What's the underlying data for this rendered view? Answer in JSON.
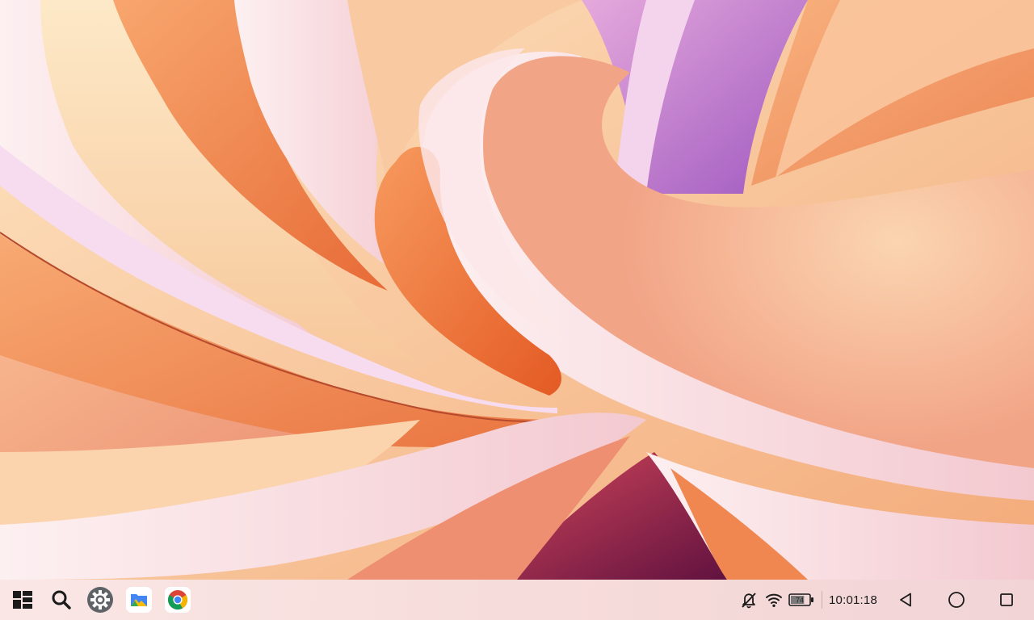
{
  "taskbar": {
    "apps": [
      {
        "name": "launcher",
        "icon": "grid-apps-icon"
      },
      {
        "name": "search",
        "icon": "search-icon"
      },
      {
        "name": "settings",
        "icon": "gear-icon"
      },
      {
        "name": "files",
        "icon": "folder-icon"
      },
      {
        "name": "chrome",
        "icon": "chrome-icon"
      }
    ],
    "tray": {
      "battery_level": "74",
      "battery_fraction": 0.74,
      "clock": "10:01:18"
    },
    "nav": [
      "back-icon",
      "home-icon",
      "recents-icon"
    ]
  },
  "colors": {
    "wallpaper_peach": "#f7c49a",
    "wallpaper_orange": "#ef7b3f",
    "wallpaper_pink": "#f8dfe3",
    "wallpaper_purple": "#b56fc8",
    "taskbar_bg": "#f6dede"
  }
}
